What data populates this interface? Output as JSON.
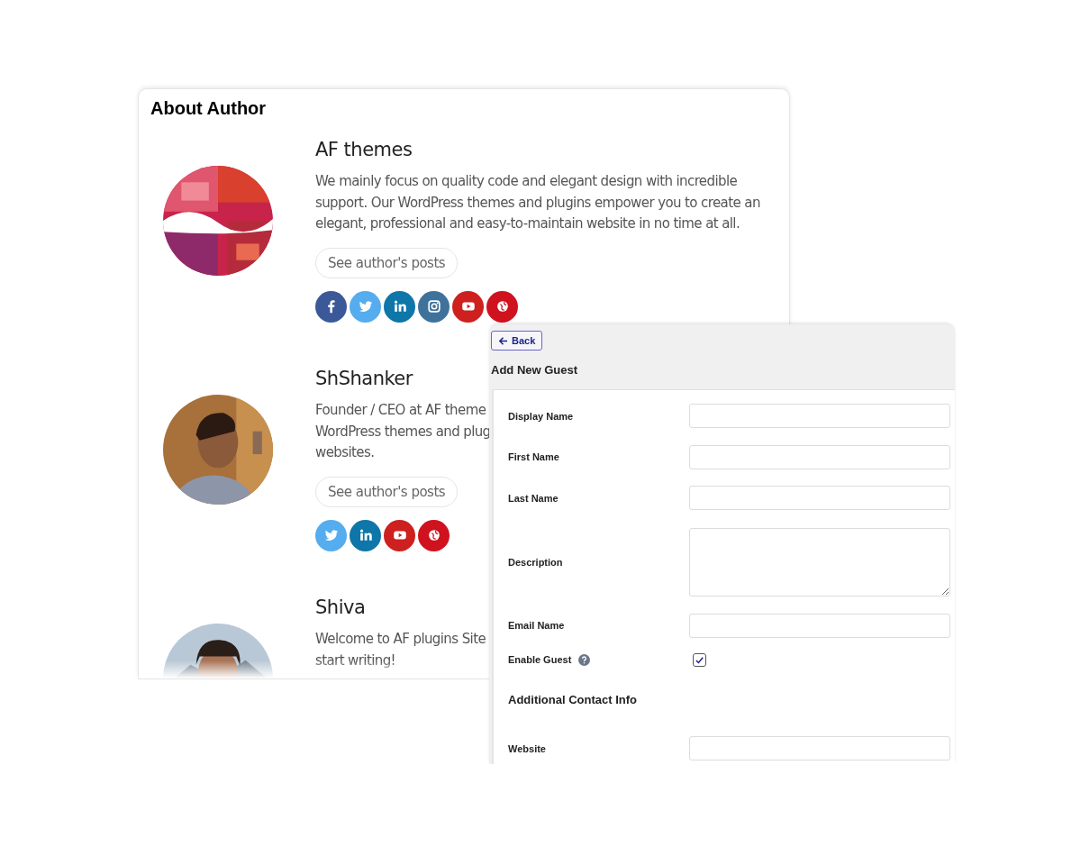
{
  "about_card": {
    "title": "About Author",
    "authors": [
      {
        "name": "AF themes",
        "avatar": {
          "kind": "picture"
        },
        "bio_lines": [
          "We mainly focus on quality code and elegant design with incredible",
          "support. Our WordPress themes and plugins empower you to create an",
          "elegant, professional and easy-to-maintain website in no time at all."
        ],
        "posts_button": "See author's posts",
        "socials": [
          {
            "kind": "facebook"
          },
          {
            "kind": "twitter"
          },
          {
            "kind": "linkedin"
          },
          {
            "kind": "instagram"
          },
          {
            "kind": "youtube"
          },
          {
            "kind": "globe"
          }
        ]
      },
      {
        "name": "ShShanker",
        "avatar": {
          "kind": "picture"
        },
        "bio_lines": [
          "Founder / CEO at AF theme",
          "WordPress themes and plug",
          "websites."
        ],
        "posts_button": "See author's posts",
        "socials": [
          {
            "kind": "twitter"
          },
          {
            "kind": "linkedin"
          },
          {
            "kind": "youtube"
          },
          {
            "kind": "globe"
          }
        ]
      },
      {
        "name": "Shiva",
        "avatar": {
          "kind": "picture"
        },
        "bio_lines": [
          "Welcome to AF plugins Site",
          "start writing!"
        ]
      }
    ]
  },
  "guest_form": {
    "back_button": "Back",
    "title": "Add New Guest",
    "rows": [
      {
        "kind": "text",
        "label": "Display Name"
      },
      {
        "kind": "text",
        "label": "First Name"
      },
      {
        "kind": "text",
        "label": "Last Name"
      },
      {
        "kind": "textarea",
        "label": "Description"
      },
      {
        "kind": "text",
        "label": "Email Name"
      },
      {
        "kind": "checkbox",
        "label": "Enable Guest",
        "help": true,
        "checked": true
      },
      {
        "kind": "heading",
        "label": "Additional Contact Info"
      },
      {
        "kind": "text",
        "label": "Website"
      }
    ]
  }
}
